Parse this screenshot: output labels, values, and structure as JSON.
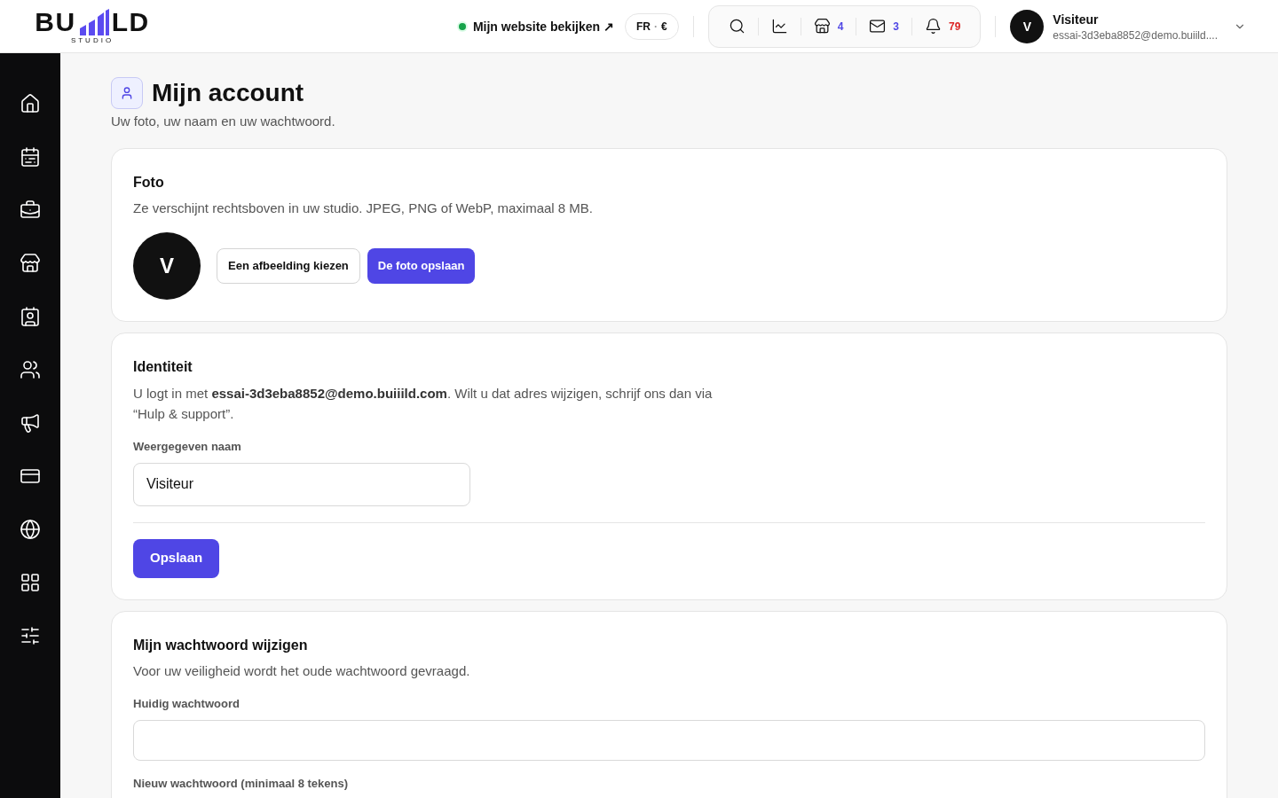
{
  "logo": {
    "left": "BU",
    "right": "LD",
    "sub": "STUDIO"
  },
  "header": {
    "site_link": "Mijn website bekijken ↗",
    "locale": {
      "language": "FR",
      "separator": "·",
      "currency": "€"
    },
    "tools": [
      {
        "kind": "search"
      },
      {
        "kind": "stats"
      },
      {
        "kind": "shop",
        "count": "4",
        "color": "#4f46e5"
      },
      {
        "kind": "mail",
        "count": "3",
        "color": "#4f46e5"
      },
      {
        "kind": "bell",
        "count": "79",
        "color": "#dc2626"
      }
    ],
    "user": {
      "initial": "V",
      "name": "Visiteur",
      "email": "essai-3d3eba8852@demo.buiild...."
    }
  },
  "page": {
    "title": "Mijn account",
    "subtitle": "Uw foto, uw naam en uw wachtwoord."
  },
  "photo_card": {
    "title": "Foto",
    "description": "Ze verschijnt rechtsboven in uw studio. JPEG, PNG of WebP, maximaal 8 MB.",
    "avatar": "V",
    "choose_button": "Een afbeelding kiezen",
    "save_button": "De foto opslaan"
  },
  "identity_card": {
    "title": "Identiteit",
    "description": "U logt in met **essai-3d3eba8852@demo.buiiild.com**. Wilt u dat adres wijzigen, schrijf ons dan via “Hulp & support”.",
    "name_label": "Weergegeven naam",
    "name_value": "Visiteur",
    "save_button": "Opslaan"
  },
  "password_card": {
    "title": "Mijn wachtwoord wijzigen",
    "description": "Voor uw veiligheid wordt het oude wachtwoord gevraagd.",
    "fields": [
      {
        "label": "Huidig wachtwoord"
      },
      {
        "label": "Nieuw wachtwoord (minimaal 8 tekens)"
      }
    ]
  }
}
